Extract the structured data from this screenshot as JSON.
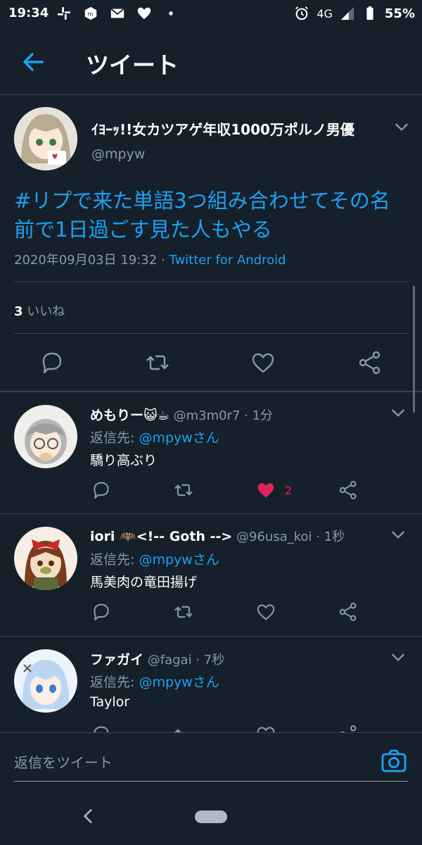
{
  "status_bar": {
    "time": "19:34",
    "network": "4G",
    "battery": "55%",
    "icons_left": [
      "slack-icon",
      "m-app-icon",
      "mail-icon",
      "heart-icon",
      "dot-icon"
    ],
    "icons_right": [
      "alarm-icon",
      "signal-icon",
      "battery-icon"
    ]
  },
  "header": {
    "title": "ツイート",
    "back_icon": "arrow-left-icon"
  },
  "main_tweet": {
    "author_name": "ｲﾖｰｯ!!女カツアゲ年収1000万ポルノ男優",
    "handle": "@mpyw",
    "text": "#リプで来た単語3つ組み合わせてその名前で1日過ごす見た人もやる",
    "date": "2020年09月03日 19:32",
    "separator": "·",
    "source": "Twitter for Android",
    "likes_count": "3",
    "likes_label": "いいね"
  },
  "replies": [
    {
      "name": "めもりー😺☕",
      "handle": "@m3m0r7",
      "time": "1分",
      "reply_to_label": "返信先:",
      "reply_to": "@mpywさん",
      "text": "驕り高ぶり",
      "likes": "2",
      "liked": true
    },
    {
      "name": "iori 🦇<!-- Goth -->",
      "handle": "@96usa_koi",
      "time": "1秒",
      "reply_to_label": "返信先:",
      "reply_to": "@mpywさん",
      "text": "馬美肉の竜田揚げ",
      "likes": "",
      "liked": false
    },
    {
      "name": "ファガイ",
      "handle": "@fagai",
      "time": "7秒",
      "reply_to_label": "返信先:",
      "reply_to": "@mpywさん",
      "text": "Taylor",
      "likes": "",
      "liked": false
    }
  ],
  "reply_box": {
    "placeholder": "返信をツイート",
    "camera_icon": "camera-icon"
  },
  "colors": {
    "background": "#15202b",
    "accent": "#1da1f2",
    "muted": "#8899a6",
    "like": "#e0245e",
    "divider": "#38444d"
  }
}
